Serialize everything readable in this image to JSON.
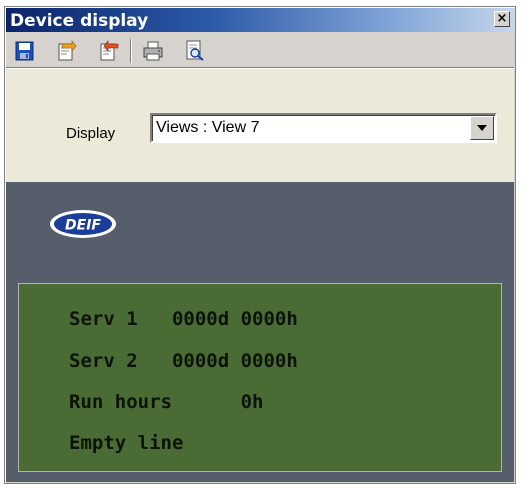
{
  "window": {
    "title": "Device display",
    "close_glyph": "×"
  },
  "toolbar": {
    "buttons": [
      {
        "icon": "save-icon"
      },
      {
        "icon": "write-to-device-icon"
      },
      {
        "icon": "read-from-device-icon"
      },
      {
        "icon": "print-icon"
      },
      {
        "icon": "print-preview-icon"
      }
    ]
  },
  "display": {
    "label": "Display",
    "selected": "Views : View 7"
  },
  "logo": {
    "text": "DEIF"
  },
  "lcd": {
    "lines": [
      "Serv 1   0000d 0000h",
      "Serv 2   0000d 0000h",
      "Run hours      0h",
      "Empty line"
    ]
  },
  "colors": {
    "titlebar": "#0a246a",
    "lcd_background": "#4a6b34",
    "screen_background": "#565e6b",
    "logo_blue": "#1a3e9a"
  }
}
